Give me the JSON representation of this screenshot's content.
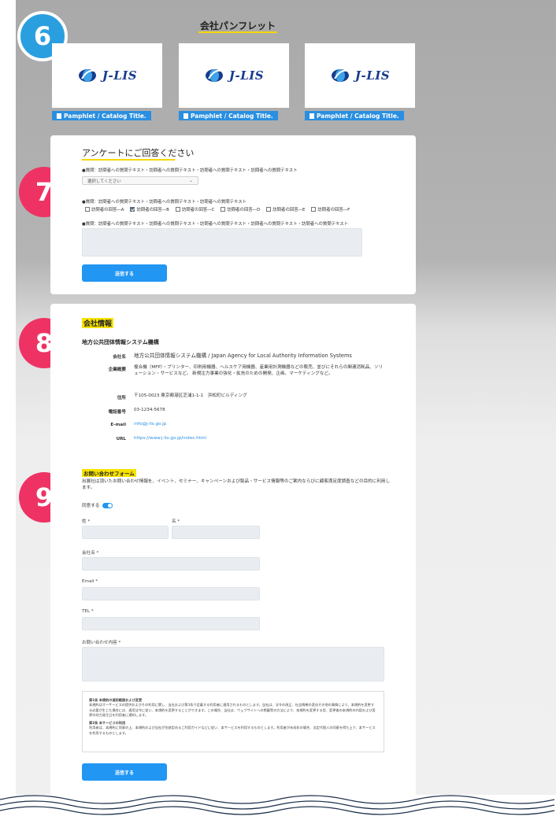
{
  "badges": {
    "b6": "6",
    "b7": "7",
    "b8": "8",
    "b9": "9"
  },
  "pamphlets": {
    "title": "会社パンフレット",
    "items": [
      {
        "logo_text": "J-LIS",
        "label": "Pamphlet / Catalog Title."
      },
      {
        "logo_text": "J-LIS",
        "label": "Pamphlet / Catalog Title."
      },
      {
        "logo_text": "J-LIS",
        "label": "Pamphlet / Catalog Title."
      }
    ]
  },
  "survey": {
    "title": "アンケートにご回答ください",
    "q1": "●質問：訪問者への質問テキスト・訪問者への質問テキスト・訪問者への質問テキスト・訪問者への質問テキスト",
    "select_value": "選択してください",
    "q2": "●質問：訪問者への質問テキスト・訪問者への質問テキスト・訪問者への質問テキスト",
    "options": [
      {
        "label": "訪問者の回答―A",
        "checked": false
      },
      {
        "label": "訪問者の回答―B",
        "checked": true
      },
      {
        "label": "訪問者の回答―C",
        "checked": false
      },
      {
        "label": "訪問者の回答―D",
        "checked": false
      },
      {
        "label": "訪問者の回答―E",
        "checked": false
      },
      {
        "label": "訪問者の回答―F",
        "checked": false
      }
    ],
    "q3": "●質問：訪問者への質問テキスト・訪問者への質問テキスト・訪問者への質問テキスト・訪問者への質問テキスト・訪問者への質問テキスト",
    "submit_label": "送信する"
  },
  "company": {
    "heading": "会社情報",
    "org_name": "地方公共団体情報システム機構",
    "rows": {
      "name_key": "会社名",
      "name_val": "地方公共団体情報システム機構 / Japan Agency for Local Authority Information Systems",
      "biz_key": "企業概要",
      "biz_val": "複合機（MFP）・プリンター、印刷用機器、ヘルスケア用機器、産業用計測機器などの販売、並びにそれらの関連消耗品、ソリューション・サービスなど。 新規注力事業の強化・拡充のための開発、企画、マーケティングなど。",
      "addr_key": "住所",
      "addr_val": "〒105-0023 東京都港区芝浦1-1-1　浜松町ビルディング",
      "tel_key": "電話番号",
      "tel_val": "03-1234-5678",
      "email_key": "E-mail",
      "email_val": "info@j-lis.go.jp",
      "url_key": "URL",
      "url_val": "https://www.j-lis.go.jp/index.html"
    }
  },
  "inquiry": {
    "heading": "お問い合わせフォーム",
    "desc": "出展社は頂いたお問い合わせ情報を、イベント、セミナー、キャンペーンおよび製品・サービス情報等のご案内ならびに顧客満足度調査などの目的に利用します。",
    "agree_label": "同意する",
    "last_name_label": "姓 *",
    "first_name_label": "名 *",
    "company_label": "会社名 *",
    "email_label": "Email *",
    "tel_label": "TEL *",
    "message_label": "お問い合わせ内容 *",
    "terms": {
      "h1": "第1条 本規約の適用範囲および変更",
      "p1": "本規約はオーサービスの提供およびその利用に関し、当社および第3条で定義する利用者に適用されるものとします。当社は、法令の改正、社会情勢の変化その他の事情により、本規約を変更する必要が生じた場合には、適用法令に従い、本規約を変更することができます。この場合、当社は、ウェブサイトへの掲載等の方法により、本規約を変更する旨、変更後の本規約の内容および変更の効力発生日を利用者に通知します。",
      "h2": "第2条 本サービスの利用",
      "p2": "利用者は、本規約に同意の上、本規約および当社が別途定めるご利用ガイドなどに従い、本サービスを利用するものとします。利用者が未成年の場合、法定代理人の同意を得た上で、本サービスを利用するものとします。"
    },
    "submit_label": "送信する"
  }
}
